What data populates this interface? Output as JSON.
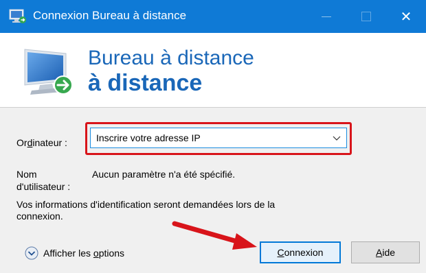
{
  "titlebar": {
    "title": "Connexion Bureau à distance",
    "icon": "remote-desktop-icon",
    "minimize_icon": "minimize-icon",
    "maximize_icon": "maximize-icon",
    "close_icon": "close-icon",
    "close_glyph": "✕"
  },
  "banner": {
    "line1": "Bureau à distance",
    "line2": "à distance",
    "icon": "remote-desktop-monitor-icon"
  },
  "form": {
    "computer_label_pre": "Or",
    "computer_label_accel": "d",
    "computer_label_post": "inateur :",
    "computer_value": "Inscrire votre adresse IP",
    "username_label_line1": "Nom",
    "username_label_line2": "d'utilisateur :",
    "username_value": "Aucun paramètre n'a été spécifié.",
    "info_line1": "Vos informations d'identification seront demandées lors de la",
    "info_line2": "connexion."
  },
  "footer": {
    "options_pre": "Afficher les ",
    "options_accel": "o",
    "options_post": "ptions",
    "connect_accel": "C",
    "connect_rest": "onnexion",
    "help_accel": "A",
    "help_rest": "ide"
  },
  "annotations": {
    "highlight_color": "#d8141a",
    "arrow_color": "#d8141a"
  },
  "colors": {
    "titlebar": "#0f7ad6",
    "banner_text": "#1a67b8",
    "focus_blue": "#0078d7"
  }
}
